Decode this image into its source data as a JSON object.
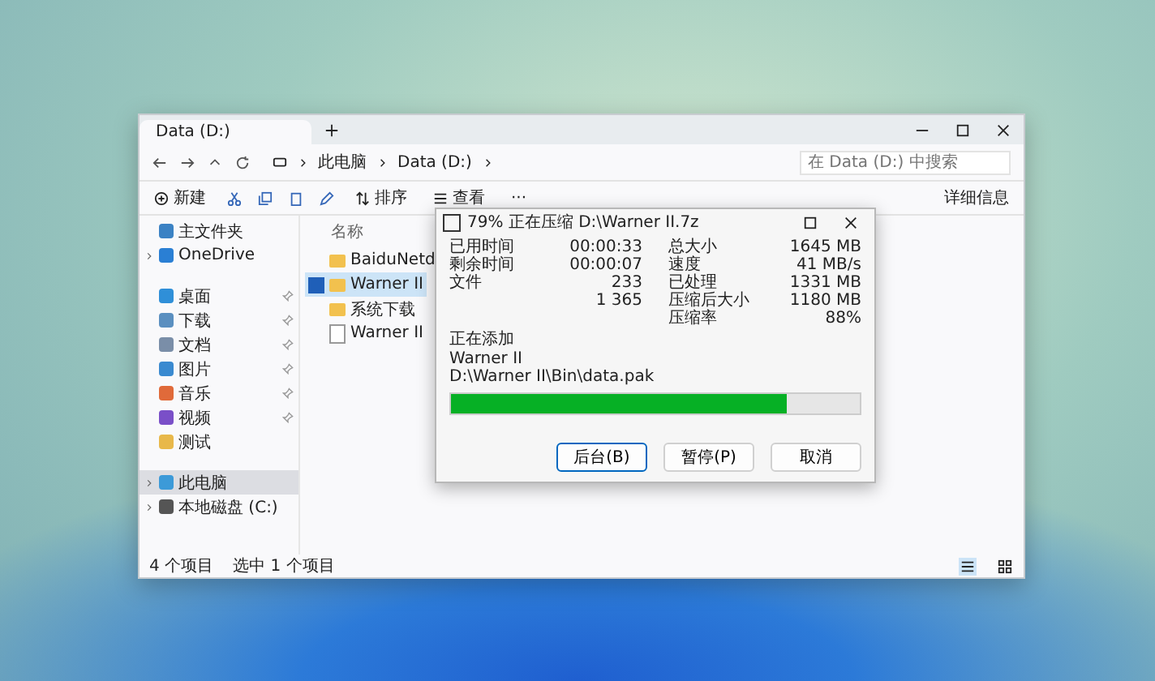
{
  "explorer": {
    "tab": "Data (D:)",
    "breadcrumb": [
      "此电脑",
      "Data (D:)"
    ],
    "search": {
      "placeholder": "在 Data (D:) 中搜索"
    },
    "toolbar": {
      "new": "新建",
      "sort": "排序",
      "view": "查看",
      "more": "···",
      "details": "详细信息"
    },
    "sidebar": [
      {
        "label": "主文件夹",
        "pinned": false,
        "expandable": false,
        "selected": false
      },
      {
        "label": "OneDrive",
        "pinned": false,
        "expandable": true,
        "selected": false
      },
      {
        "label": "桌面",
        "pinned": true,
        "expandable": false,
        "selected": false
      },
      {
        "label": "下载",
        "pinned": true,
        "expandable": false,
        "selected": false
      },
      {
        "label": "文档",
        "pinned": true,
        "expandable": false,
        "selected": false
      },
      {
        "label": "图片",
        "pinned": true,
        "expandable": false,
        "selected": false
      },
      {
        "label": "音乐",
        "pinned": true,
        "expandable": false,
        "selected": false
      },
      {
        "label": "视频",
        "pinned": true,
        "expandable": false,
        "selected": false
      },
      {
        "label": "测试",
        "pinned": false,
        "expandable": false,
        "selected": false
      },
      {
        "label": "此电脑",
        "pinned": false,
        "expandable": true,
        "selected": true
      },
      {
        "label": "本地磁盘 (C:)",
        "pinned": false,
        "expandable": true,
        "selected": false
      }
    ],
    "column": "名称",
    "files": [
      {
        "name": "BaiduNetd",
        "kind": "folder",
        "selected": false
      },
      {
        "name": "Warner II",
        "kind": "folder",
        "selected": true
      },
      {
        "name": "系统下载",
        "kind": "folder",
        "selected": false
      },
      {
        "name": "Warner II",
        "kind": "file",
        "selected": false
      }
    ],
    "status": [
      "4 个项目",
      "选中 1 个项目"
    ]
  },
  "dialog": {
    "title": "79% 正在压缩 D:\\Warner II.7z",
    "left": [
      {
        "label": "已用时间",
        "value": "00:00:33"
      },
      {
        "label": "剩余时间",
        "value": "00:00:07"
      },
      {
        "label": "文件",
        "value": "233"
      },
      {
        "value": "1 365"
      }
    ],
    "right": [
      {
        "label": "总大小",
        "value": "1645 MB"
      },
      {
        "label": "速度",
        "value": "41 MB/s"
      },
      {
        "label": "已处理",
        "value": "1331 MB"
      },
      {
        "label": "压缩后大小",
        "value": "1180 MB"
      },
      {
        "label": "压缩率",
        "value": "88%"
      }
    ],
    "action": "正在添加",
    "lines": [
      "Warner II",
      "D:\\Warner II\\Bin\\data.pak"
    ],
    "progress": {
      "level": 0.82
    },
    "buttons": [
      {
        "label": "后台(B)",
        "selected": true
      },
      {
        "label": "暂停(P)",
        "selected": false
      },
      {
        "label": "取消",
        "selected": false
      }
    ]
  }
}
